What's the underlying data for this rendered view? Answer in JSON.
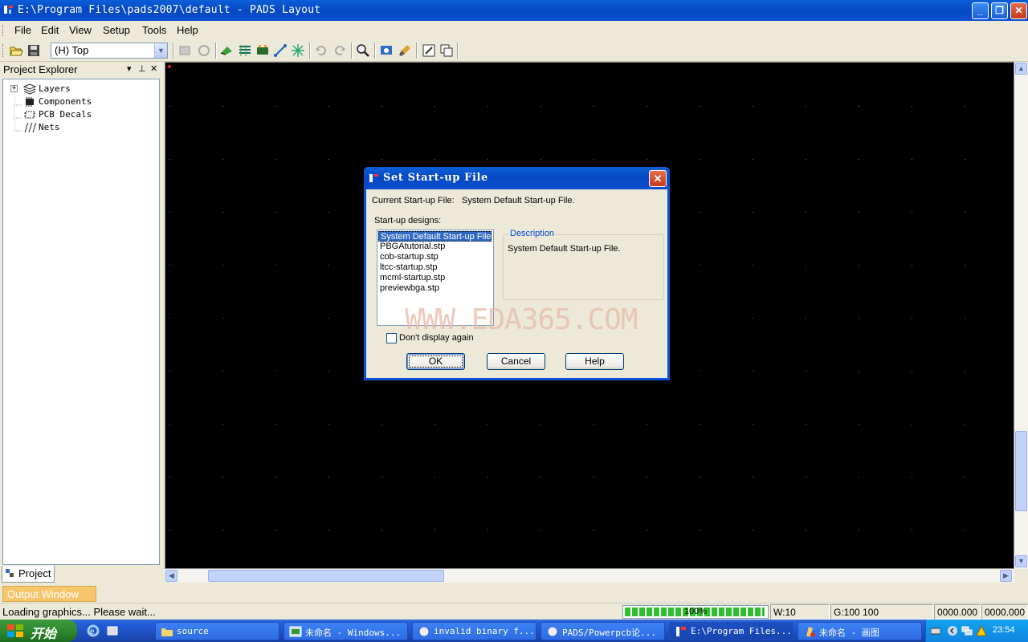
{
  "window": {
    "title": "E:\\Program Files\\pads2007\\default - PADS Layout",
    "controls": {
      "minimize": "_",
      "restore": "❐",
      "close": "✕"
    }
  },
  "menu": [
    "File",
    "Edit",
    "View",
    "Setup",
    "Tools",
    "Help"
  ],
  "toolbar": {
    "layer_select": "(H) Top"
  },
  "explorer": {
    "title": "Project Explorer",
    "pin": "⊥",
    "close": "✕",
    "dropdown": "▾",
    "expander": "+",
    "items": [
      {
        "label": "Layers",
        "icon": "layers-icon"
      },
      {
        "label": "Components",
        "icon": "components-icon"
      },
      {
        "label": "PCB Decals",
        "icon": "pcb-decals-icon"
      },
      {
        "label": "Nets",
        "icon": "nets-icon"
      }
    ],
    "tab": "Project"
  },
  "output": {
    "tab": "Output Window"
  },
  "status": {
    "message": "Loading graphics... Please wait...",
    "progress_percent": 100,
    "progress_label": "100%",
    "width": "W:10",
    "grid": "G:100 100",
    "x": "0000.000",
    "y": "0000.000"
  },
  "dialog": {
    "title": "Set Start-up File",
    "close": "✕",
    "current_label": "Current Start-up File:",
    "current_value": "System Default Start-up File.",
    "designs_label": "Start-up designs:",
    "designs": [
      "System Default Start-up File.",
      "PBGAtutorial.stp",
      "cob-startup.stp",
      "ltcc-startup.stp",
      "mcml-startup.stp",
      "previewbga.stp"
    ],
    "selected_index": 0,
    "description_legend": "Description",
    "description_text": "System Default Start-up File.",
    "dont_display_label": "Don't display again",
    "ok": "OK",
    "cancel": "Cancel",
    "help": "Help",
    "watermark": "WWW.EDA365.COM"
  },
  "taskbar": {
    "start": "开始",
    "tasks": [
      {
        "label": "source"
      },
      {
        "label": "未命名 - Windows..."
      },
      {
        "label": "invalid binary f..."
      },
      {
        "label": "PADS/Powerpcb论..."
      },
      {
        "label": "E:\\Program Files..."
      },
      {
        "label": "未命名 - 画图"
      }
    ],
    "clock": "23:54"
  },
  "colors": {
    "titlebar": "#0a52d8",
    "canvas_bg": "#000000",
    "selection": "#316ac5",
    "output_tab": "#f7c56b",
    "progress": "#2fbe2f"
  }
}
